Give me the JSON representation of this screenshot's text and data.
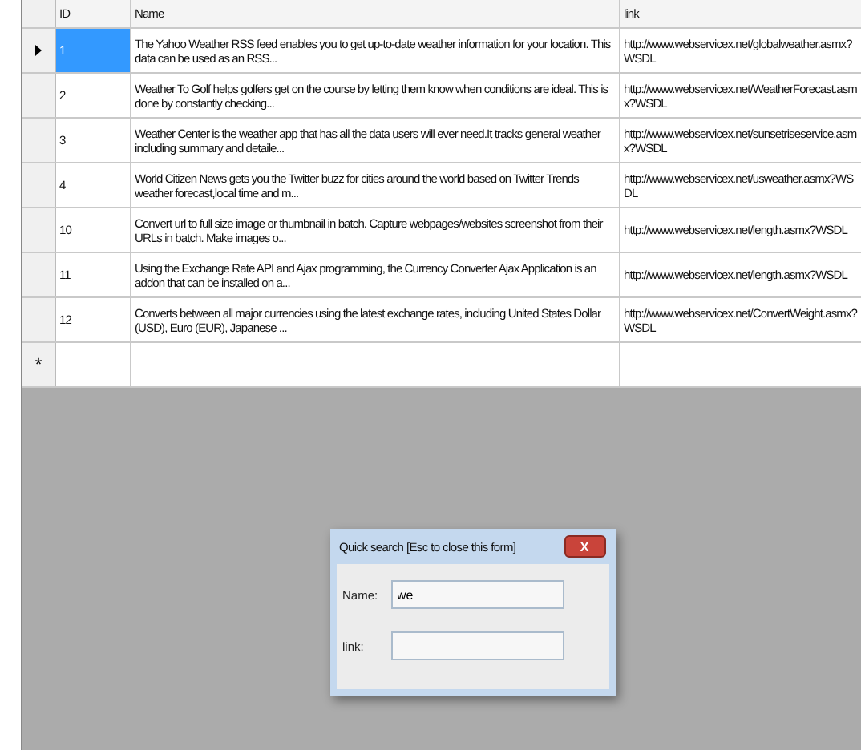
{
  "table": {
    "columns": [
      "ID",
      "Name",
      "link"
    ],
    "rows": [
      {
        "current": true,
        "selected": true,
        "cells": [
          "1",
          "The Yahoo Weather RSS feed enables you to get up-to-date weather information for your location. This data can be used as an RSS...",
          "http://www.webservicex.net/globalweather.asmx?WSDL"
        ]
      },
      {
        "current": false,
        "selected": false,
        "cells": [
          "2",
          "Weather To Golf helps golfers get on the course by letting them know when conditions are ideal. This is done by constantly checking...",
          "http://www.webservicex.net/WeatherForecast.asmx?WSDL"
        ]
      },
      {
        "current": false,
        "selected": false,
        "cells": [
          "3",
          "Weather Center is the weather app that has all the data users will ever need.It tracks general weather including summary and detaile...",
          "http://www.webservicex.net/sunsetriseservice.asmx?WSDL"
        ]
      },
      {
        "current": false,
        "selected": false,
        "cells": [
          "4",
          "World Citizen News gets you the Twitter buzz for cities around the world based on Twitter Trends weather forecast,local time and  m...",
          "http://www.webservicex.net/usweather.asmx?WSDL"
        ]
      },
      {
        "current": false,
        "selected": false,
        "cells": [
          "10",
          "Convert url to full size image or thumbnail in batch. Capture webpages/websites screenshot from their URLs in batch. Make images o...",
          "http://www.webservicex.net/length.asmx?WSDL"
        ]
      },
      {
        "current": false,
        "selected": false,
        "cells": [
          "11",
          "Using the Exchange Rate API and Ajax programming, the Currency Converter Ajax Application is an addon that can be installed on a...",
          "http://www.webservicex.net/length.asmx?WSDL"
        ]
      },
      {
        "current": false,
        "selected": false,
        "cells": [
          "12",
          "Converts between all major currencies using the latest exchange rates, including United States Dollar (USD), Euro (EUR), Japanese ...",
          "http://www.webservicex.net/ConvertWeight.asmx?WSDL"
        ]
      }
    ],
    "new_row_marker": "*"
  },
  "dialog": {
    "title": "Quick search [Esc to close this form]",
    "close": "X",
    "fields": [
      {
        "label": "Name:",
        "value": "we"
      },
      {
        "label": "link:"
      }
    ]
  }
}
